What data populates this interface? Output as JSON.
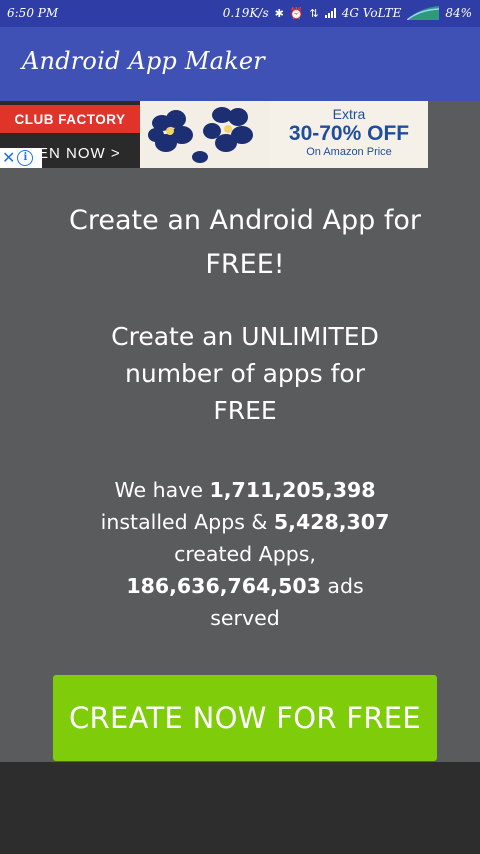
{
  "status_bar": {
    "time": "6:50 PM",
    "speed": "0.19K/s",
    "network": "4G VoLTE",
    "battery": "84%",
    "icons": [
      "bluetooth-icon",
      "alarm-icon",
      "data-arrows-icon",
      "signal-icon",
      "battery-icon"
    ]
  },
  "app_bar": {
    "title": "Android App Maker",
    "color": "#3f51b5"
  },
  "ad": {
    "brand": "CLUB FACTORY",
    "cta": "EN NOW >",
    "extra": "Extra",
    "offer": "30-70% OFF",
    "sub": "On Amazon Price"
  },
  "content": {
    "headline_line1": "Create an Android App for",
    "headline_line2": "FREE!",
    "sub_line1": "Create an UNLIMITED",
    "sub_line2": "number of apps for",
    "sub_line3": "FREE",
    "stats": {
      "prefix": "We have ",
      "installed_count": "1,711,205,398",
      "installed_text": "installed Apps & ",
      "created_count": "5,428,307",
      "created_text": "created Apps,",
      "ads_count": "186,636,764,503",
      "ads_text": " ads",
      "served_text": "served"
    },
    "button_label": "CREATE NOW FOR FREE",
    "button_color": "#7fcc0b"
  }
}
